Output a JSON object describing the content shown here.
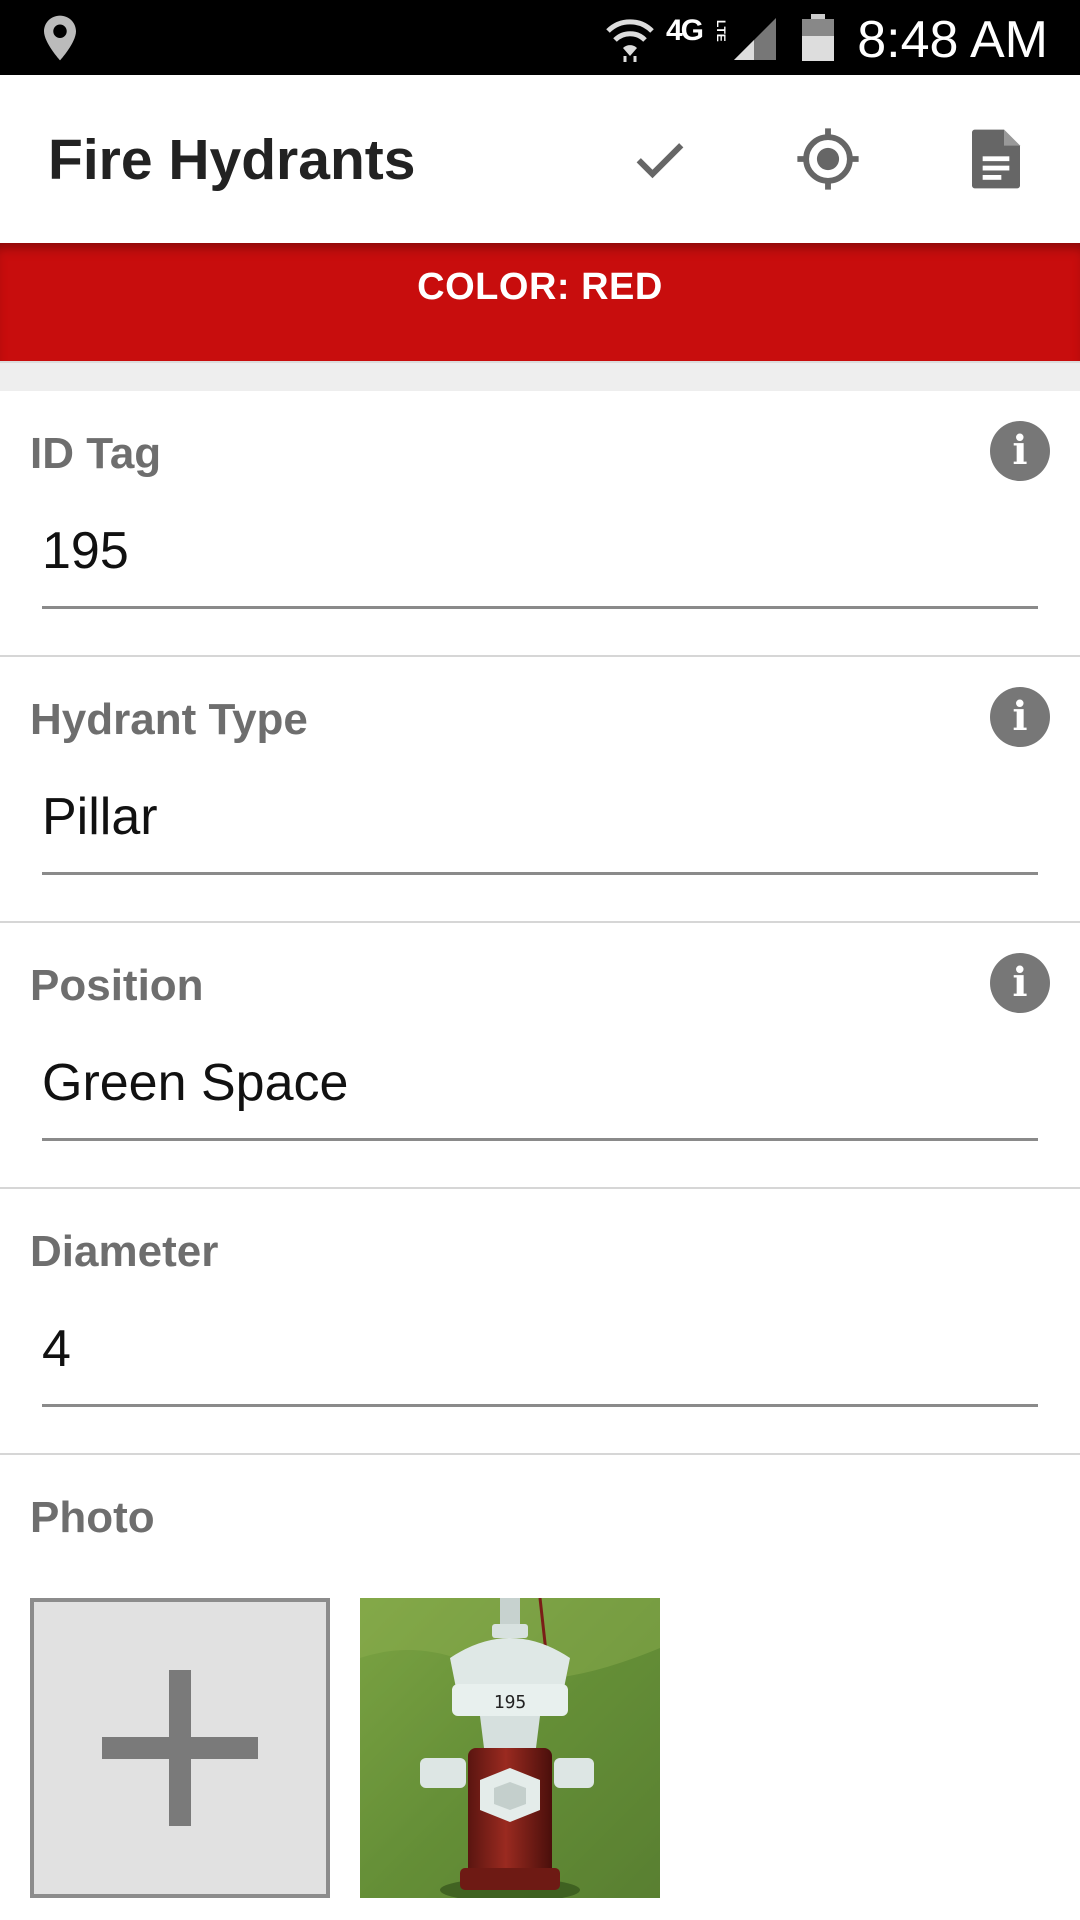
{
  "status_bar": {
    "network": "4G",
    "network_sub": "LTE",
    "time": "8:48 AM",
    "icons": [
      "location-icon",
      "wifi-icon",
      "signal-icon",
      "battery-icon"
    ]
  },
  "app_bar": {
    "title": "Fire Hydrants",
    "actions": [
      "check-icon",
      "gps-target-icon",
      "document-icon"
    ]
  },
  "banner": {
    "text": "COLOR: RED",
    "color": "#c80d0d"
  },
  "fields": [
    {
      "label": "ID Tag",
      "value": "195",
      "has_info": true
    },
    {
      "label": "Hydrant Type",
      "value": "Pillar",
      "has_info": true
    },
    {
      "label": "Position",
      "value": "Green Space",
      "has_info": true
    },
    {
      "label": "Diameter",
      "value": "4",
      "has_info": false
    }
  ],
  "photo": {
    "label": "Photo",
    "thumbnail_tag": "195"
  },
  "colors": {
    "accent_red": "#c80d0d",
    "label_gray": "#6e6e6e",
    "info_gray": "#777777"
  }
}
